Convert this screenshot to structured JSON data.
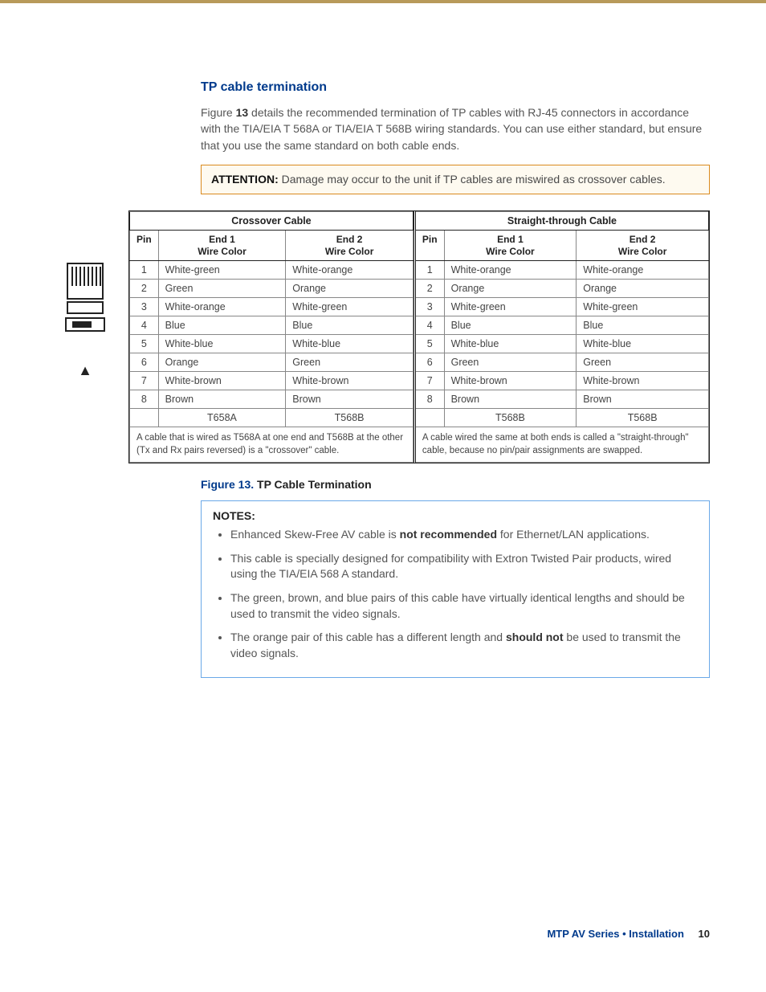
{
  "section_title": "TP cable termination",
  "intro": {
    "prefix": "Figure ",
    "fignum": "13",
    "rest": " details the recommended termination of TP cables with RJ-45 connectors in accordance with the TIA/EIA T 568A or TIA/EIA T 568B wiring standards. You can use either standard, but ensure that you use the same standard on both cable ends."
  },
  "attention": {
    "label": "ATTENTION:",
    "text": "Damage may occur to the unit if TP cables are miswired as crossover cables."
  },
  "tables": {
    "crossover": {
      "title": "Crossover Cable",
      "headers": {
        "pin": "Pin",
        "end1": "End 1\nWire Color",
        "end2": "End 2\nWire Color"
      },
      "rows": [
        {
          "pin": "1",
          "end1": "White-green",
          "end2": "White-orange"
        },
        {
          "pin": "2",
          "end1": "Green",
          "end2": "Orange"
        },
        {
          "pin": "3",
          "end1": "White-orange",
          "end2": "White-green"
        },
        {
          "pin": "4",
          "end1": "Blue",
          "end2": "Blue"
        },
        {
          "pin": "5",
          "end1": "White-blue",
          "end2": "White-blue"
        },
        {
          "pin": "6",
          "end1": "Orange",
          "end2": "Green"
        },
        {
          "pin": "7",
          "end1": "White-brown",
          "end2": "White-brown"
        },
        {
          "pin": "8",
          "end1": "Brown",
          "end2": "Brown"
        }
      ],
      "std": {
        "end1": "T658A",
        "end2": "T568B"
      },
      "footnote": "A cable that is wired as T568A at one end and T568B at the other (Tx and Rx pairs reversed) is a \"crossover\" cable."
    },
    "straight": {
      "title": "Straight-through Cable",
      "headers": {
        "pin": "Pin",
        "end1": "End 1\nWire Color",
        "end2": "End 2\nWire Color"
      },
      "rows": [
        {
          "pin": "1",
          "end1": "White-orange",
          "end2": "White-orange"
        },
        {
          "pin": "2",
          "end1": "Orange",
          "end2": "Orange"
        },
        {
          "pin": "3",
          "end1": "White-green",
          "end2": "White-green"
        },
        {
          "pin": "4",
          "end1": "Blue",
          "end2": "Blue"
        },
        {
          "pin": "5",
          "end1": "White-blue",
          "end2": "White-blue"
        },
        {
          "pin": "6",
          "end1": "Green",
          "end2": "Green"
        },
        {
          "pin": "7",
          "end1": "White-brown",
          "end2": "White-brown"
        },
        {
          "pin": "8",
          "end1": "Brown",
          "end2": "Brown"
        }
      ],
      "std": {
        "end1": "T568B",
        "end2": "T568B"
      },
      "footnote": "A cable wired the same at both ends is called a \"straight-through\" cable, because no pin/pair assignments are swapped."
    }
  },
  "figure_caption": {
    "label": "Figure 13.",
    "text": "TP Cable Termination"
  },
  "notes": {
    "label": "NOTES:",
    "items": [
      {
        "pre": "Enhanced Skew-Free AV cable is ",
        "bold": "not recommended",
        "post": " for Ethernet/LAN applications."
      },
      {
        "pre": "This cable is specially designed for compatibility with Extron Twisted Pair products, wired using the TIA/EIA 568 A standard.",
        "bold": "",
        "post": ""
      },
      {
        "pre": "The green, brown, and blue pairs of this cable have virtually identical lengths and should be used to transmit the video signals.",
        "bold": "",
        "post": ""
      },
      {
        "pre": "The orange pair of this cable has a different length and ",
        "bold": "should not",
        "post": " be used to transmit the video signals."
      }
    ]
  },
  "footer": {
    "series": "MTP AV Series • Installation",
    "page": "10"
  }
}
